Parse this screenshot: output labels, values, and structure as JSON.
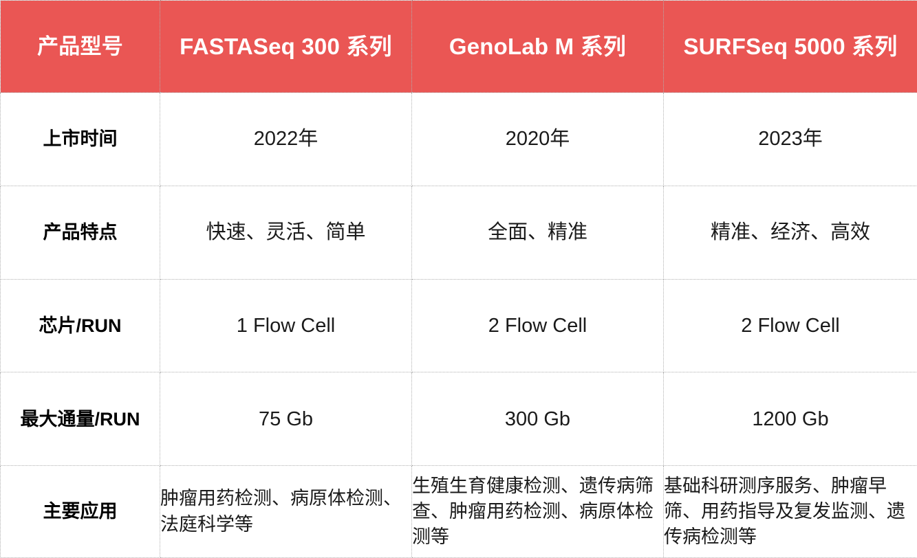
{
  "table": {
    "accent_color": "#ea5654",
    "header_text_color": "#ffffff",
    "grid_color": "#b0b0b0",
    "headers": [
      "产品型号",
      "FASTASeq 300 系列",
      "GenoLab M 系列",
      "SURFSeq 5000 系列"
    ],
    "rows": [
      {
        "label": "上市时间",
        "values": [
          "2022年",
          "2020年",
          "2023年"
        ]
      },
      {
        "label": "产品特点",
        "values": [
          "快速、灵活、简单",
          "全面、精准",
          "精准、经济、高效"
        ]
      },
      {
        "label": "芯片/RUN",
        "values": [
          "1 Flow Cell",
          "2 Flow Cell",
          "2 Flow Cell"
        ]
      },
      {
        "label": "最大通量/RUN",
        "values": [
          "75 Gb",
          "300 Gb",
          "1200 Gb"
        ]
      },
      {
        "label": "主要应用",
        "values": [
          "肿瘤用药检测、病原体检测、法庭科学等",
          "生殖生育健康检测、遗传病筛查、肿瘤用药检测、病原体检测等",
          "基础科研测序服务、肿瘤早筛、用药指导及复发监测、遗传病检测等"
        ]
      }
    ]
  }
}
